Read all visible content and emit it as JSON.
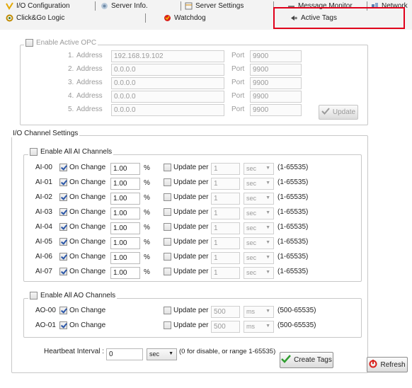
{
  "tabs": {
    "row1": [
      {
        "label": "I/O Configuration",
        "icon": "io-config-icon"
      },
      {
        "label": "Server Info.",
        "icon": "server-info-icon"
      },
      {
        "label": "Server Settings",
        "icon": "server-settings-icon"
      },
      {
        "label": "Message Monitor",
        "icon": "message-monitor-icon"
      },
      {
        "label": "Network",
        "icon": "network-icon"
      }
    ],
    "row2": [
      {
        "label": "Click&Go Logic",
        "icon": "click-go-icon"
      },
      {
        "label": "Watchdog",
        "icon": "watchdog-icon"
      },
      {
        "label": "Active Tags",
        "icon": "active-tags-icon"
      }
    ],
    "active": "Active Tags",
    "highlight_color": "#e0001b"
  },
  "active_opc": {
    "enable_label": "Enable Active OPC",
    "enabled": false,
    "address_label": "Address",
    "port_label": "Port",
    "rows": [
      {
        "index": "1.",
        "address": "192.168.19.102",
        "port": "9900"
      },
      {
        "index": "2.",
        "address": "0.0.0.0",
        "port": "9900"
      },
      {
        "index": "3.",
        "address": "0.0.0.0",
        "port": "9900"
      },
      {
        "index": "4.",
        "address": "0.0.0.0",
        "port": "9900"
      },
      {
        "index": "5.",
        "address": "0.0.0.0",
        "port": "9900"
      }
    ],
    "update_button": "Update"
  },
  "io_channel": {
    "title": "I/O Channel Settings",
    "ai_group": {
      "enable_label": "Enable All AI Channels",
      "enabled": false,
      "channels": [
        {
          "name": "AI-00",
          "on_change_label": "On Change",
          "on_change": true,
          "value": "1.00",
          "unit": "%",
          "update_per_label": "Update per",
          "update_per": false,
          "period": "1",
          "period_unit": "sec",
          "range": "(1-65535)"
        },
        {
          "name": "AI-01",
          "on_change_label": "On Change",
          "on_change": true,
          "value": "1.00",
          "unit": "%",
          "update_per_label": "Update per",
          "update_per": false,
          "period": "1",
          "period_unit": "sec",
          "range": "(1-65535)"
        },
        {
          "name": "AI-02",
          "on_change_label": "On Change",
          "on_change": true,
          "value": "1.00",
          "unit": "%",
          "update_per_label": "Update per",
          "update_per": false,
          "period": "1",
          "period_unit": "sec",
          "range": "(1-65535)"
        },
        {
          "name": "AI-03",
          "on_change_label": "On Change",
          "on_change": true,
          "value": "1.00",
          "unit": "%",
          "update_per_label": "Update per",
          "update_per": false,
          "period": "1",
          "period_unit": "sec",
          "range": "(1-65535)"
        },
        {
          "name": "AI-04",
          "on_change_label": "On Change",
          "on_change": true,
          "value": "1.00",
          "unit": "%",
          "update_per_label": "Update per",
          "update_per": false,
          "period": "1",
          "period_unit": "sec",
          "range": "(1-65535)"
        },
        {
          "name": "AI-05",
          "on_change_label": "On Change",
          "on_change": true,
          "value": "1.00",
          "unit": "%",
          "update_per_label": "Update per",
          "update_per": false,
          "period": "1",
          "period_unit": "sec",
          "range": "(1-65535)"
        },
        {
          "name": "AI-06",
          "on_change_label": "On Change",
          "on_change": true,
          "value": "1.00",
          "unit": "%",
          "update_per_label": "Update per",
          "update_per": false,
          "period": "1",
          "period_unit": "sec",
          "range": "(1-65535)"
        },
        {
          "name": "AI-07",
          "on_change_label": "On Change",
          "on_change": true,
          "value": "1.00",
          "unit": "%",
          "update_per_label": "Update per",
          "update_per": false,
          "period": "1",
          "period_unit": "sec",
          "range": "(1-65535)"
        }
      ]
    },
    "ao_group": {
      "enable_label": "Enable All AO Channels",
      "enabled": false,
      "channels": [
        {
          "name": "AO-00",
          "on_change_label": "On Change",
          "on_change": true,
          "update_per_label": "Update per",
          "update_per": false,
          "period": "500",
          "period_unit": "ms",
          "range": "(500-65535)"
        },
        {
          "name": "AO-01",
          "on_change_label": "On Change",
          "on_change": true,
          "update_per_label": "Update per",
          "update_per": false,
          "period": "500",
          "period_unit": "ms",
          "range": "(500-65535)"
        }
      ]
    },
    "heartbeat": {
      "label": "Heartbeat Interval :",
      "value": "0",
      "unit": "sec",
      "hint": "(0 for disable, or range 1-65535)"
    },
    "create_tags_button": "Create Tags"
  },
  "refresh_button": "Refresh",
  "colors": {
    "check_green": "#2f9e2f",
    "refresh_red": "#d9201b"
  }
}
